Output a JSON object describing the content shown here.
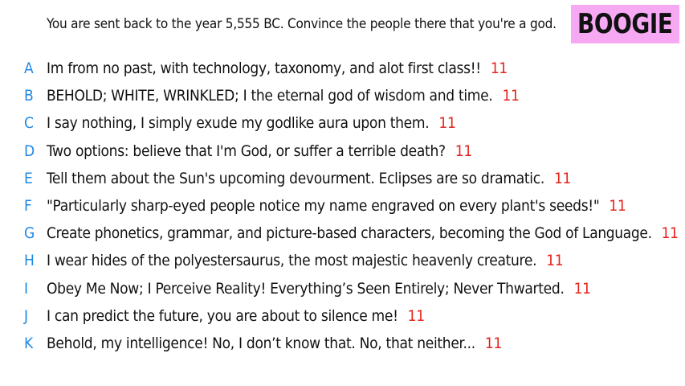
{
  "prompt": "You are sent back to the year 5,555 BC. Convince the people there that you're a god.",
  "brand": "BOOGIE",
  "colors": {
    "letter": "#1e88e5",
    "score": "#e5221d",
    "brand_bg": "#f7a8f2"
  },
  "answers": [
    {
      "letter": "A",
      "text": "Im from no past, with technology, taxonomy, and alot first class!!",
      "score": "11"
    },
    {
      "letter": "B",
      "text": "BEHOLD; WHITE, WRINKLED; I the eternal god of wisdom and time.",
      "score": "11"
    },
    {
      "letter": "C",
      "text": "I say nothing, I simply exude my godlike aura upon them.",
      "score": "11"
    },
    {
      "letter": "D",
      "text": "Two options: believe that I'm God, or suffer a terrible death?",
      "score": "11"
    },
    {
      "letter": "E",
      "text": "Tell them about the Sun's upcoming devourment. Eclipses are so dramatic.",
      "score": "11"
    },
    {
      "letter": "F",
      "text": "\"Particularly sharp-eyed people notice my name engraved on every plant's seeds!\"",
      "score": "11"
    },
    {
      "letter": "G",
      "text": "Create phonetics, grammar, and picture-based characters, becoming the God of Language.",
      "score": "11"
    },
    {
      "letter": "H",
      "text": "I wear hides of the polyestersaurus, the most majestic heavenly creature.",
      "score": "11"
    },
    {
      "letter": "I",
      "text": "Obey Me Now; I Perceive Reality! Everything’s Seen Entirely; Never Thwarted.",
      "score": "11"
    },
    {
      "letter": "J",
      "text": "I can predict the future, you are about to silence me!",
      "score": "11"
    },
    {
      "letter": "K",
      "text": "Behold, my intelligence! No, I don’t know that. No, that neither...",
      "score": "11"
    }
  ]
}
